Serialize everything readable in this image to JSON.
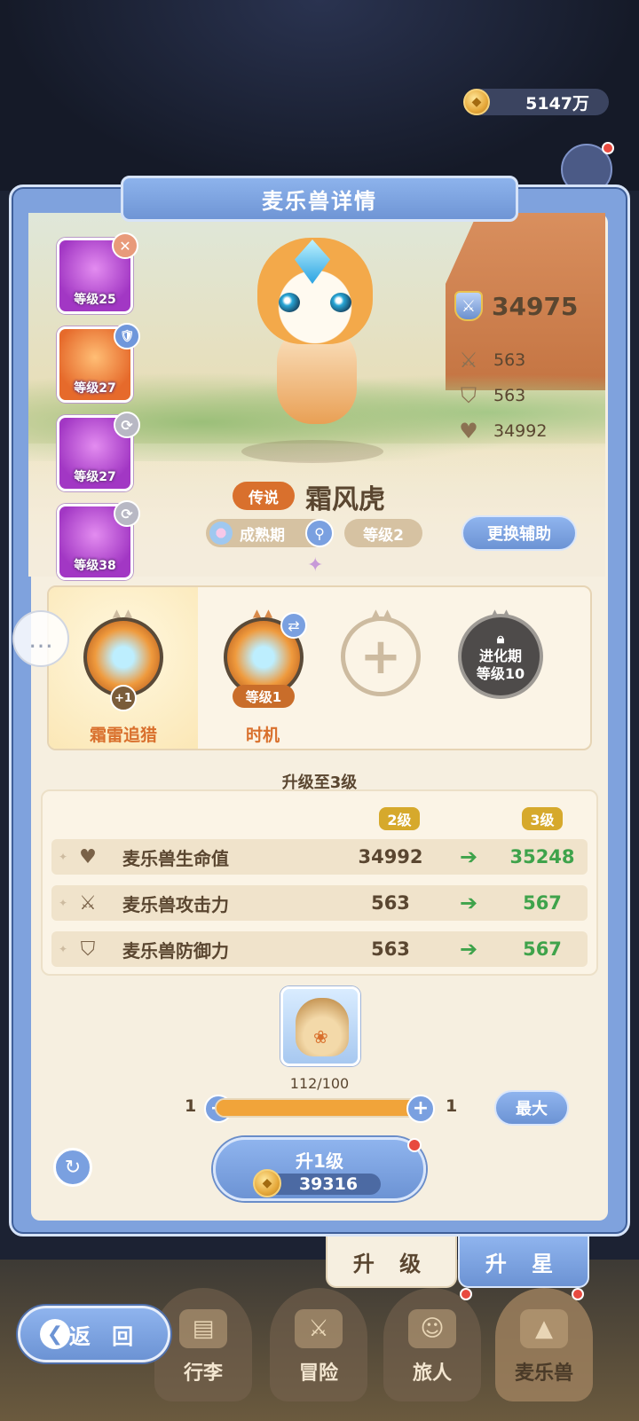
{
  "currency": {
    "gold": "5147万"
  },
  "panel": {
    "title": "麦乐兽详情"
  },
  "team": [
    {
      "level": "等级25",
      "badge": "✕"
    },
    {
      "level": "等级27",
      "badge": "🛡"
    },
    {
      "level": "等级27",
      "badge": "⟳"
    },
    {
      "level": "等级38",
      "badge": "⟳"
    }
  ],
  "stats": {
    "power": "34975",
    "attack": "563",
    "defense": "563",
    "hp": "34992"
  },
  "monster": {
    "rarity": "传说",
    "name": "霜风虎",
    "stage": "成熟期",
    "level": "等级2",
    "switch_label": "更换辅助"
  },
  "skills": {
    "active": {
      "name": "霜雷追猎",
      "badge": "+1"
    },
    "second": {
      "name": "时机",
      "level": "等级1"
    },
    "locked": {
      "line1": "进化期",
      "line2": "等级10"
    }
  },
  "upgrade": {
    "title": "升级至3级",
    "from_level": "2级",
    "to_level": "3级",
    "rows": [
      {
        "label": "麦乐兽生命值",
        "from": "34992",
        "to": "35248"
      },
      {
        "label": "麦乐兽攻击力",
        "from": "563",
        "to": "567"
      },
      {
        "label": "麦乐兽防御力",
        "from": "563",
        "to": "567"
      }
    ]
  },
  "item": {
    "count": "112/100"
  },
  "slider": {
    "min": "1",
    "max": "1",
    "max_button": "最大",
    "fill_fraction": 1.0
  },
  "upgrade_button": {
    "label": "升1级",
    "cost": "39316"
  },
  "tabs": {
    "upgrade": "升 级",
    "star": "升 星"
  },
  "nav": {
    "bag": "行李",
    "adventure": "冒险",
    "traveler": "旅人",
    "monster": "麦乐兽",
    "back": "返 回"
  },
  "colors": {
    "accent_blue": "#7aa0e0",
    "rarity_orange": "#d9702d",
    "increase_green": "#3fa34b",
    "level_gold": "#d6a92c"
  }
}
